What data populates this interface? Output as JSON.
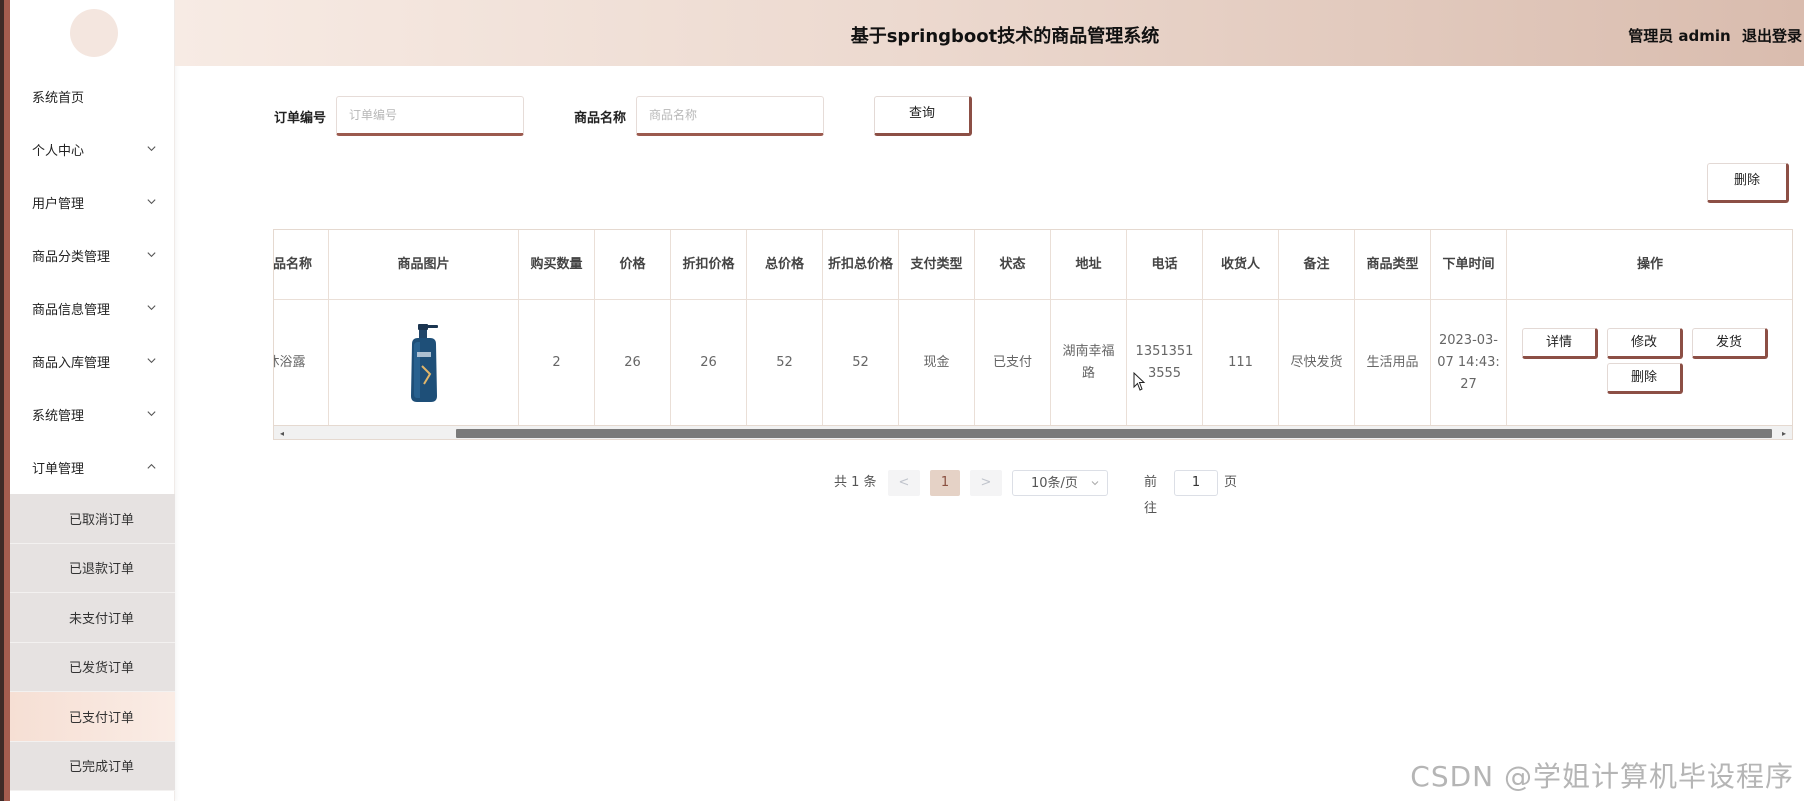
{
  "header": {
    "title": "基于springboot技术的商品管理系统",
    "user_label": "管理员 admin",
    "logout_label": "退出登录"
  },
  "sidebar": {
    "items": [
      {
        "label": "系统首页",
        "expandable": false
      },
      {
        "label": "个人中心",
        "expandable": true
      },
      {
        "label": "用户管理",
        "expandable": true
      },
      {
        "label": "商品分类管理",
        "expandable": true
      },
      {
        "label": "商品信息管理",
        "expandable": true
      },
      {
        "label": "商品入库管理",
        "expandable": true
      },
      {
        "label": "系统管理",
        "expandable": true
      },
      {
        "label": "订单管理",
        "expandable": true,
        "expanded": true
      }
    ],
    "subitems": [
      {
        "label": "已取消订单"
      },
      {
        "label": "已退款订单"
      },
      {
        "label": "未支付订单"
      },
      {
        "label": "已发货订单"
      },
      {
        "label": "已支付订单",
        "active": true
      },
      {
        "label": "已完成订单"
      }
    ]
  },
  "search": {
    "order_no_label": "订单编号",
    "order_no_placeholder": "订单编号",
    "order_no_value": "",
    "product_name_label": "商品名称",
    "product_name_placeholder": "商品名称",
    "product_name_value": "",
    "query_label": "查询"
  },
  "toolbar": {
    "delete_label": "删除"
  },
  "table": {
    "headers": [
      "商品名称",
      "商品图片",
      "购买数量",
      "价格",
      "折扣价格",
      "总价格",
      "折扣总价格",
      "支付类型",
      "状态",
      "地址",
      "电话",
      "收货人",
      "备注",
      "商品类型",
      "下单时间",
      "操作"
    ],
    "rows": [
      {
        "cells": [
          "沐浴露",
          "",
          "2",
          "26",
          "26",
          "52",
          "52",
          "现金",
          "已支付",
          "湖南幸福路",
          "13513513555",
          "111",
          "尽快发货",
          "生活用品",
          "2023-03-07 14:43:27"
        ],
        "image_icon": "shower-gel-bottle-icon",
        "actions": [
          "详情",
          "修改",
          "发货",
          "删除"
        ]
      }
    ]
  },
  "pagination": {
    "total_label": "共 1 条",
    "prev_label": "<",
    "current_page": "1",
    "next_label": ">",
    "page_size_label": "10条/页",
    "goto_label": "前往",
    "goto_value": "1",
    "page_unit": "页"
  },
  "watermark": "CSDN @学姐计算机毕设程序",
  "colors": {
    "accent": "#8c4f45",
    "header_gradient_start": "#f7ebe4",
    "header_gradient_end": "#d9bcae",
    "active_submenu": "#f6dfd4",
    "submenu_bg": "#e6e2e1"
  }
}
